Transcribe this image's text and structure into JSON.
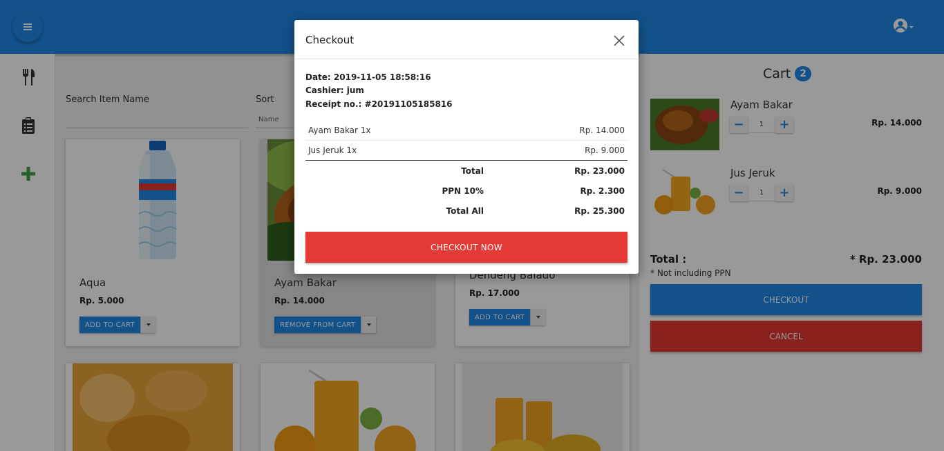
{
  "header": {
    "menu_icon": "hamburger-icon",
    "user_icon": "account-circle-icon"
  },
  "sidebar": {
    "items": [
      {
        "icon": "utensils-icon",
        "color": "#333333"
      },
      {
        "icon": "clipboard-list-icon",
        "color": "#333333"
      },
      {
        "icon": "plus-icon",
        "color": "#43a047"
      }
    ]
  },
  "filters": {
    "search_label": "Search Item Name",
    "sort_label": "Sort",
    "sort_value": "Name"
  },
  "products": [
    {
      "name": "Aqua",
      "price": "Rp. 5.000",
      "button": "ADD TO CART",
      "in_cart": false
    },
    {
      "name": "Ayam Bakar",
      "price": "Rp. 14.000",
      "button": "REMOVE FROM CART",
      "in_cart": true
    },
    {
      "name": "Dendeng Balado",
      "price": "Rp. 17.000",
      "button": "ADD TO CART",
      "in_cart": false
    }
  ],
  "cart": {
    "title": "Cart",
    "count": "2",
    "items": [
      {
        "name": "Ayam Bakar",
        "qty": "1",
        "price": "Rp. 14.000"
      },
      {
        "name": "Jus Jeruk",
        "qty": "1",
        "price": "Rp. 9.000"
      }
    ],
    "total_label": "Total :",
    "total_value": "* Rp. 23.000",
    "note": "* Not including PPN",
    "checkout_label": "CHECKOUT",
    "cancel_label": "CANCEL"
  },
  "modal": {
    "title": "Checkout",
    "date": "Date: 2019-11-05 18:58:16",
    "cashier": "Cashier: jum",
    "receipt_no": "Receipt no.: #20191105185816",
    "lines": [
      {
        "label": "Ayam Bakar 1x",
        "value": "Rp. 14.000"
      },
      {
        "label": "Jus Jeruk 1x",
        "value": "Rp. 9.000"
      }
    ],
    "summary": [
      {
        "label": "Total",
        "value": "Rp. 23.000"
      },
      {
        "label": "PPN 10%",
        "value": "Rp. 2.300"
      },
      {
        "label": "Total All",
        "value": "Rp. 25.300"
      }
    ],
    "checkout_now_label": "CHECKOUT NOW"
  },
  "colors": {
    "primary": "#1e88e5",
    "danger": "#e53935",
    "add": "#43a047"
  }
}
